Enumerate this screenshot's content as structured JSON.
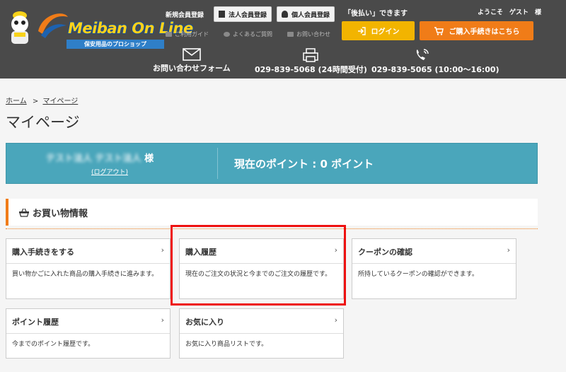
{
  "header": {
    "logo_text": "Meiban On Line",
    "logo_sub": "保安用品のプロショップ",
    "new_member_label": "新規会員登録",
    "corporate_register": "法人会員登録",
    "personal_register": "個人会員登録",
    "atobarai": "「後払い」できます",
    "welcome": "ようこそ　ゲスト　様",
    "guide": "ご利用ガイド",
    "faq": "よくあるご質問",
    "inquiry": "お問い合わせ",
    "login": "ログイン",
    "checkout": "ご購入手続きはこちら",
    "contact_form": "お問い合わせフォーム",
    "fax": "029-839-5068 (24時間受付)",
    "phone": "029-839-5065 (10:00〜16:00)"
  },
  "breadcrumb": {
    "home": "ホーム",
    "sep": ">",
    "current": "マイページ"
  },
  "page_title": "マイページ",
  "user": {
    "name_blurred": "テスト法人 テスト法人",
    "honorific": "様",
    "logout": "(ログアウト)",
    "points": "現在のポイント : 0 ポイント"
  },
  "section": {
    "title": "お買い物情報"
  },
  "cards": [
    {
      "title": "購入手続きをする",
      "desc": "買い物かごに入れた商品の購入手続きに進みます。"
    },
    {
      "title": "購入履歴",
      "desc": "現在のご注文の状況と今までのご注文の履歴です。"
    },
    {
      "title": "クーポンの確認",
      "desc": "所持しているクーポンの確認ができます。"
    },
    {
      "title": "ポイント履歴",
      "desc": "今までのポイント履歴です。"
    },
    {
      "title": "お気に入り",
      "desc": "お気に入り商品リストです。"
    }
  ],
  "chevron": "›",
  "colors": {
    "header_bg": "#4a4a4a",
    "login": "#f2b400",
    "checkout": "#f07c18",
    "userbar": "#4aa6bb",
    "highlight": "#e11111"
  }
}
